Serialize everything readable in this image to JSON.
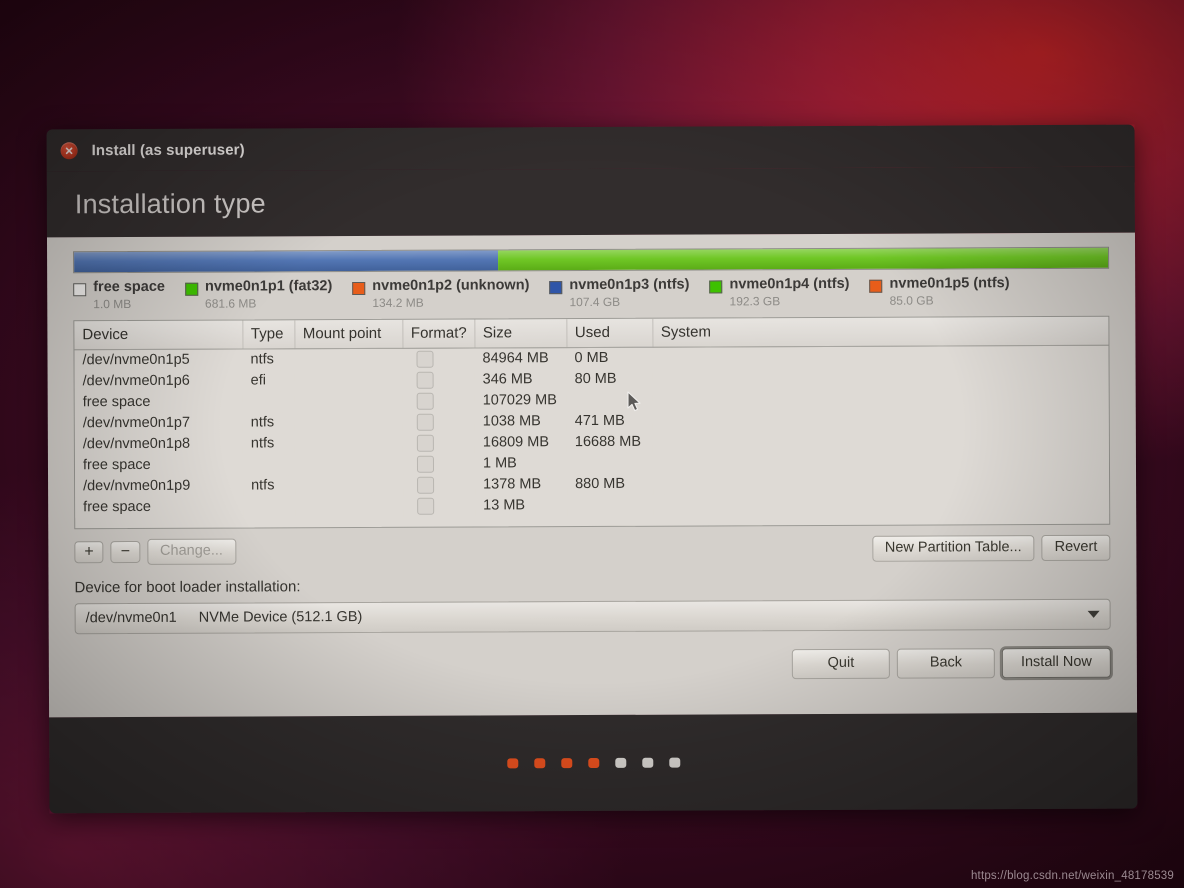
{
  "window": {
    "titlebar": {
      "title": "Install (as superuser)",
      "close_icon": "close-icon"
    },
    "page_title": "Installation type"
  },
  "partition_bar": {
    "segments": [
      {
        "label": "nvme0n1p3",
        "color": "#4a6fb0",
        "percent": 41
      },
      {
        "label": "nvme0n1p4",
        "color": "#68c41a",
        "percent": 59
      }
    ]
  },
  "legend": [
    {
      "name": "free space",
      "size": "1.0 MB",
      "color": "#f2f0ee",
      "empty": true
    },
    {
      "name": "nvme0n1p1 (fat32)",
      "size": "681.6 MB",
      "color": "#3ec100",
      "empty": false
    },
    {
      "name": "nvme0n1p2 (unknown)",
      "size": "134.2 MB",
      "color": "#e85d1a",
      "empty": false
    },
    {
      "name": "nvme0n1p3 (ntfs)",
      "size": "107.4 GB",
      "color": "#2f55a8",
      "empty": false
    },
    {
      "name": "nvme0n1p4 (ntfs)",
      "size": "192.3 GB",
      "color": "#3ec100",
      "empty": false
    },
    {
      "name": "nvme0n1p5 (ntfs)",
      "size": "85.0 GB",
      "color": "#e85d1a",
      "empty": false
    }
  ],
  "table": {
    "columns": [
      "Device",
      "Type",
      "Mount point",
      "Format?",
      "Size",
      "Used",
      "System"
    ],
    "rows": [
      {
        "device": "/dev/nvme0n1p5",
        "type": "ntfs",
        "mount": "",
        "format": false,
        "size": "84964 MB",
        "used": "0 MB",
        "system": ""
      },
      {
        "device": "/dev/nvme0n1p6",
        "type": "efi",
        "mount": "",
        "format": false,
        "size": "346 MB",
        "used": "80 MB",
        "system": ""
      },
      {
        "device": "free space",
        "type": "",
        "mount": "",
        "format": false,
        "size": "107029 MB",
        "used": "",
        "system": ""
      },
      {
        "device": "/dev/nvme0n1p7",
        "type": "ntfs",
        "mount": "",
        "format": false,
        "size": "1038 MB",
        "used": "471 MB",
        "system": ""
      },
      {
        "device": "/dev/nvme0n1p8",
        "type": "ntfs",
        "mount": "",
        "format": false,
        "size": "16809 MB",
        "used": "16688 MB",
        "system": ""
      },
      {
        "device": "free space",
        "type": "",
        "mount": "",
        "format": false,
        "size": "1 MB",
        "used": "",
        "system": ""
      },
      {
        "device": "/dev/nvme0n1p9",
        "type": "ntfs",
        "mount": "",
        "format": false,
        "size": "1378 MB",
        "used": "880 MB",
        "system": ""
      },
      {
        "device": "free space",
        "type": "",
        "mount": "",
        "format": false,
        "size": "13 MB",
        "used": "",
        "system": ""
      }
    ]
  },
  "table_toolbar": {
    "add_label": "+",
    "remove_label": "−",
    "change_label": "Change...",
    "new_partition_table_label": "New Partition Table...",
    "revert_label": "Revert"
  },
  "boot_loader": {
    "label": "Device for boot loader installation:",
    "selected_device": "/dev/nvme0n1",
    "selected_description": "NVMe Device (512.1 GB)",
    "caret_icon": "chevron-down-icon"
  },
  "actions": {
    "quit_label": "Quit",
    "back_label": "Back",
    "install_now_label": "Install Now"
  },
  "footer": {
    "dots": [
      {
        "state": "active",
        "color": "#e8511f"
      },
      {
        "state": "active",
        "color": "#e8511f"
      },
      {
        "state": "active",
        "color": "#e8511f"
      },
      {
        "state": "active",
        "color": "#e8511f"
      },
      {
        "state": "inactive",
        "color": "#d9d6d2"
      },
      {
        "state": "inactive",
        "color": "#d9d6d2"
      },
      {
        "state": "inactive",
        "color": "#d9d6d2"
      }
    ]
  },
  "watermark": "https://blog.csdn.net/weixin_48178539"
}
